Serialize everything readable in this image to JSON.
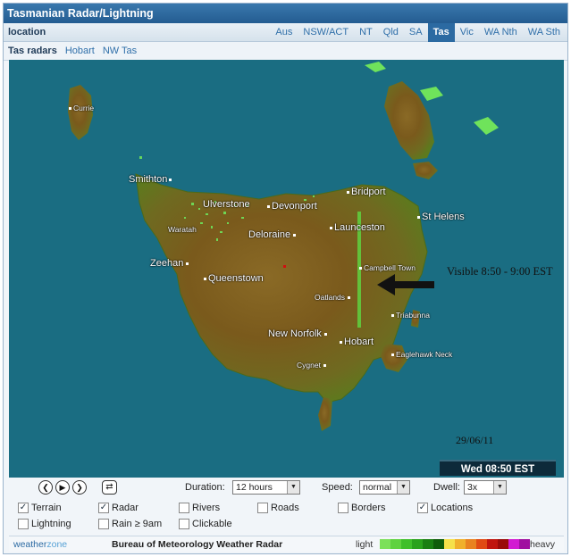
{
  "title": "Tasmanian Radar/Lightning",
  "location_label": "location",
  "state_tabs": [
    "Aus",
    "NSW/ACT",
    "NT",
    "Qld",
    "SA",
    "Tas",
    "Vic",
    "WA Nth",
    "WA Sth"
  ],
  "active_state": "Tas",
  "radar_tabs": [
    "Tas radars",
    "Hobart",
    "NW Tas"
  ],
  "map": {
    "places": {
      "currie": "Currie",
      "smithton": "Smithton",
      "ulverstone": "Ulverstone",
      "devonport": "Devonport",
      "bridport": "Bridport",
      "launceston": "Launceston",
      "st_helens": "St Helens",
      "waratah": "Waratah",
      "deloraine": "Deloraine",
      "zeehan": "Zeehan",
      "queenstown": "Queenstown",
      "campbell_town": "Campbell Town",
      "oatlands": "Oatlands",
      "triabunna": "Triabunna",
      "new_norfolk": "New Norfolk",
      "hobart": "Hobart",
      "eaglehawk_neck": "Eaglehawk Neck",
      "cygnet": "Cygnet"
    },
    "annotation": "Visible 8:50 - 9:00 EST",
    "date": "29/06/11",
    "time": "Wed 08:50 EST"
  },
  "controls": {
    "duration_label": "Duration:",
    "duration_value": "12 hours",
    "speed_label": "Speed:",
    "speed_value": "normal",
    "dwell_label": "Dwell:",
    "dwell_value": "3x"
  },
  "layers": {
    "terrain": "Terrain",
    "radar": "Radar",
    "rivers": "Rivers",
    "roads": "Roads",
    "borders": "Borders",
    "locations": "Locations",
    "lightning": "Lightning",
    "rain_9am": "Rain ≥ 9am",
    "clickable": "Clickable"
  },
  "footer": {
    "brand_a": "weather",
    "brand_b": "zone",
    "title": "Bureau of Meteorology Weather Radar",
    "light": "light",
    "heavy": "heavy"
  },
  "legend_colors": [
    "#7ce05a",
    "#5fd23f",
    "#3fbf2a",
    "#2aa21c",
    "#1a7f12",
    "#0f5c0a",
    "#f5e14a",
    "#f0b02b",
    "#e98220",
    "#e04a14",
    "#c0140e",
    "#9a0a0a",
    "#d21ad2",
    "#a010a0"
  ]
}
